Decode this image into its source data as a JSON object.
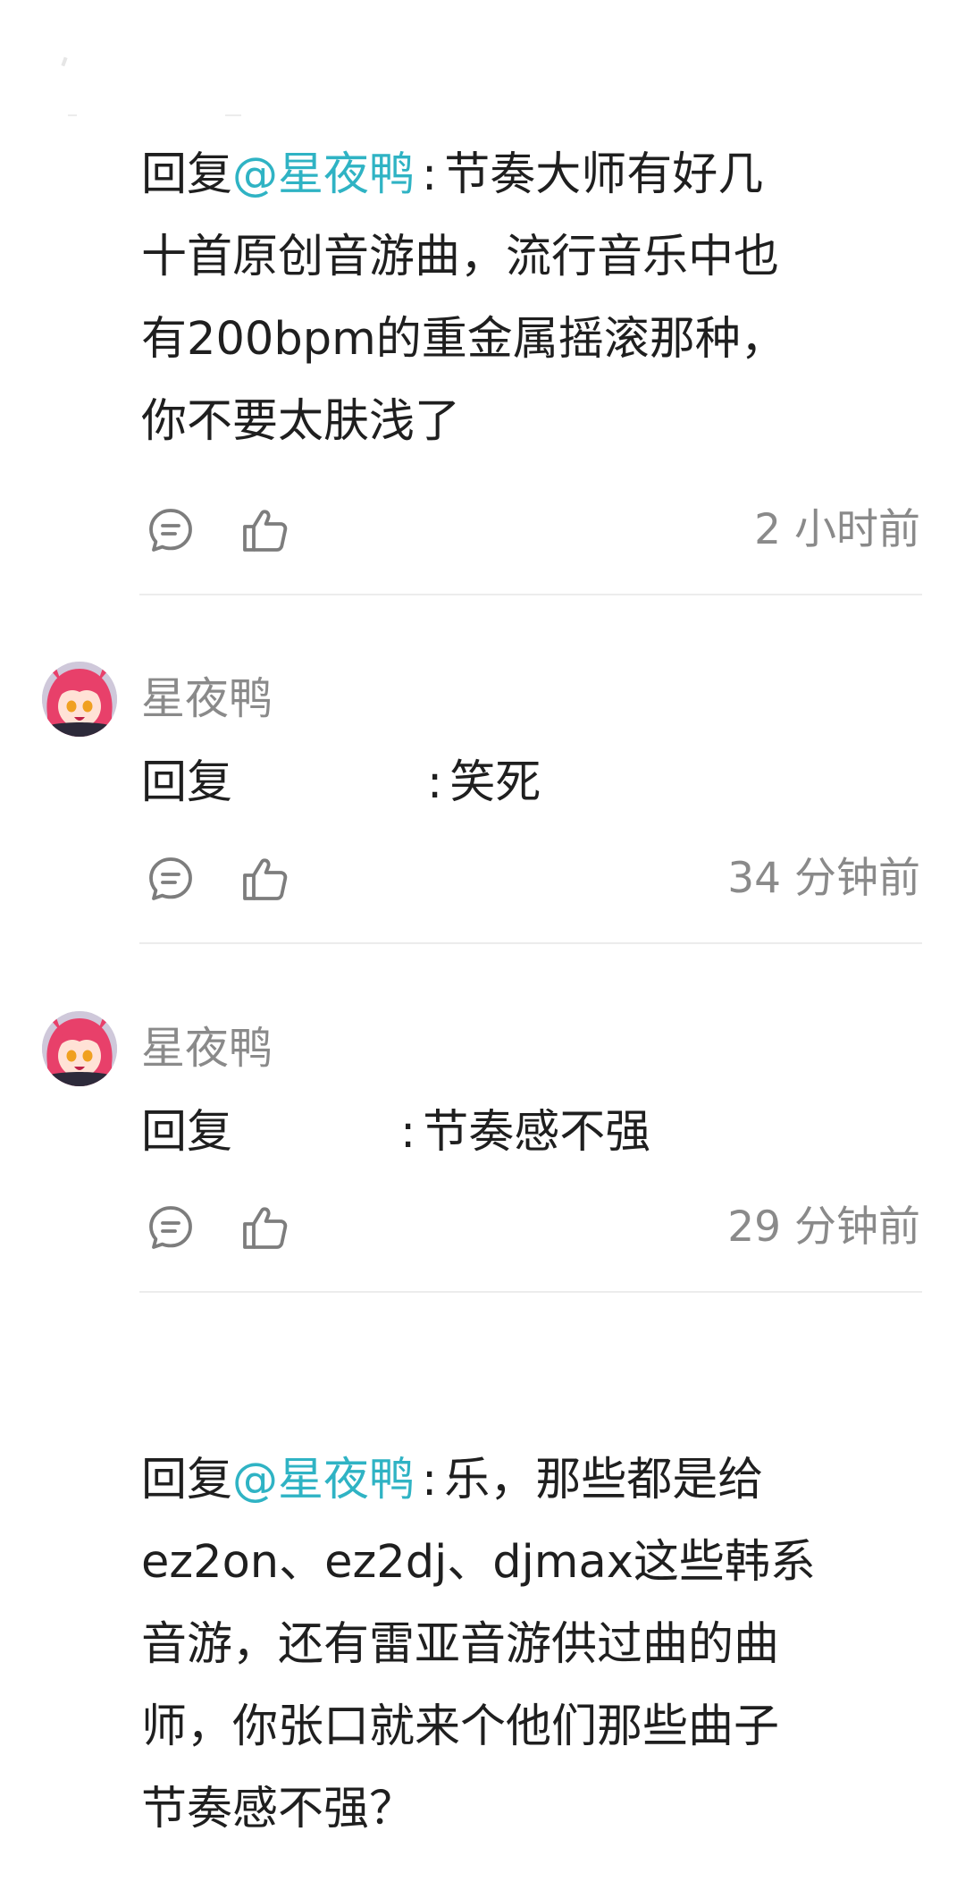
{
  "comments": [
    {
      "username": "",
      "reply_prefix": "回复",
      "mention": "@星夜鸭",
      "colon": ":",
      "lines": [
        "节奏大师有好几",
        "十首原创音游曲，流行音乐中也",
        "有200bpm的重金属摇滚那种，",
        "你不要太肤浅了"
      ],
      "time": "2 小时前"
    },
    {
      "username": "星夜鸭",
      "reply_prefix": "回复",
      "colon": ":",
      "body": "笑死",
      "time": "34 分钟前"
    },
    {
      "username": "星夜鸭",
      "reply_prefix": "回复",
      "colon": ":",
      "body": "节奏感不强",
      "time": "29 分钟前"
    },
    {
      "reply_prefix": "回复",
      "mention": "@星夜鸭",
      "colon": ":",
      "lines": [
        "乐，那些都是给",
        "ez2on、ez2dj、djmax这些韩系",
        "音游，还有雷亚音游供过曲的曲",
        "师，你张口就来个他们那些曲子",
        "节奏感不强？"
      ]
    }
  ],
  "icons": {
    "reply": "comment-bubble-icon",
    "like": "thumbs-up-icon",
    "avatar": "anime-avatar"
  },
  "colors": {
    "mention": "#2fb3c4",
    "meta": "#8a8a8a",
    "text": "#1f1f1f",
    "divider": "#ececec"
  }
}
